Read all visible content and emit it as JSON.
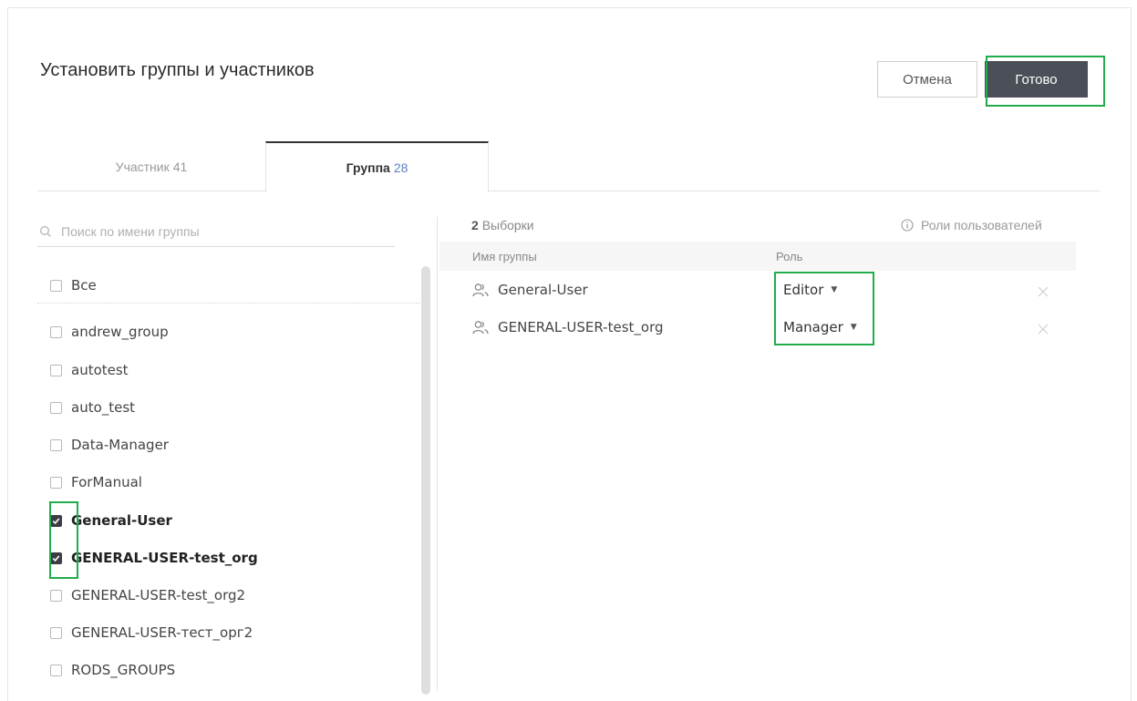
{
  "dialog": {
    "title": "Установить группы и участников",
    "cancel_label": "Отмена",
    "done_label": "Готово"
  },
  "tabs": [
    {
      "label": "Участник",
      "count": "41"
    },
    {
      "label": "Группа",
      "count": "28"
    }
  ],
  "search": {
    "placeholder": "Поиск по имени группы"
  },
  "group_list": {
    "all_label": "Все",
    "items": [
      {
        "label": "andrew_group",
        "checked": false
      },
      {
        "label": "autotest",
        "checked": false
      },
      {
        "label": "auto_test",
        "checked": false
      },
      {
        "label": "Data-Manager",
        "checked": false
      },
      {
        "label": "ForManual",
        "checked": false
      },
      {
        "label": "General-User",
        "checked": true
      },
      {
        "label": "GENERAL-USER-test_org",
        "checked": true
      },
      {
        "label": "GENERAL-USER-test_org2",
        "checked": false
      },
      {
        "label": "GENERAL-USER-тест_орг2",
        "checked": false
      },
      {
        "label": "RODS_GROUPS",
        "checked": false
      }
    ]
  },
  "selection": {
    "count": "2",
    "count_label": "Выборки",
    "roles_link": "Роли пользователей",
    "columns": {
      "name": "Имя группы",
      "role": "Роль"
    },
    "rows": [
      {
        "name": "General-User",
        "role": "Editor"
      },
      {
        "name": "GENERAL-USER-test_org",
        "role": "Manager"
      }
    ]
  },
  "colors": {
    "highlight": "#21ad4b",
    "primary_button": "#4b4f57",
    "tab_count": "#5b7fc4"
  }
}
